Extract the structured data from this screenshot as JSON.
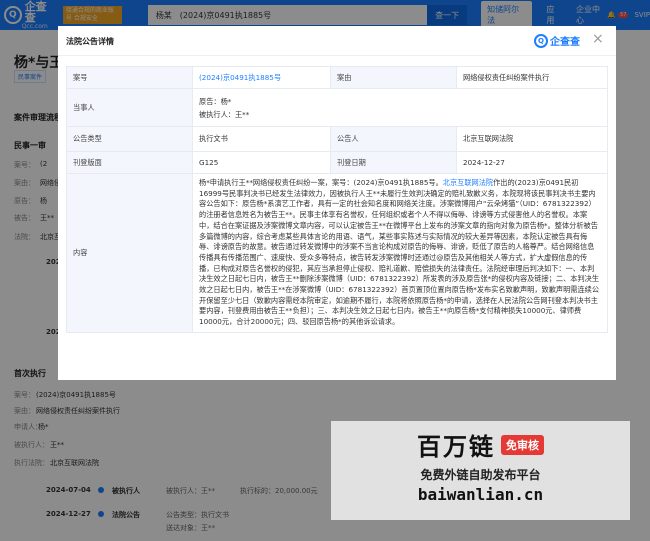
{
  "topbar": {
    "logo_text": "企查查",
    "logo_sub": "Qcc.com",
    "promo": "接通合规的商业账号 合规安全",
    "search_value": "杨某　(2024)京0491执1885号",
    "search_button": "查一下",
    "nav_item_1": "知储阿尔法",
    "nav_item_2": "应用",
    "nav_item_3": "企业中心",
    "notif_count": "57",
    "vip_label": "SVIP"
  },
  "background": {
    "company_name": "杨*与王",
    "company_tag": "民事案件",
    "section_process": "案件审理流程",
    "section_civil": "民事一审",
    "case_label": "案号：",
    "case_value": "(2",
    "cause_label": "案由：",
    "cause_value": "网络侵",
    "plaintiff_label": "原告：",
    "plaintiff_value": "杨",
    "defendant_label": "被告：",
    "defendant_value": "王**",
    "court_label": "法院：",
    "court_value": "北京互",
    "year_1": "202",
    "year_2": "202",
    "section_exec": "首次执行",
    "exec_case_label": "案号：",
    "exec_case_value": "(2024)京0491执1885号",
    "exec_cause_label": "案由：",
    "exec_cause_value": "网络侵权责任纠纷案件执行",
    "exec_applicant_label": "申请人：",
    "exec_applicant_value": "杨*",
    "exec_respondent_label": "被执行人：",
    "exec_respondent_value": "王**",
    "exec_court_label": "执行法院：",
    "exec_court_value": "北京互联网法院",
    "timeline": [
      {
        "date": "2024-07-04",
        "type": "被执行人",
        "info1": "被执行人：王**",
        "info2": "执行标的：20,000.00元"
      },
      {
        "date": "2024-12-27",
        "type": "法院公告",
        "info1": "公告类型：执行文书",
        "info2": "送达对象：王**"
      }
    ]
  },
  "modal": {
    "title": "法院公告详情",
    "logo": "企查查",
    "close": "×",
    "rows": {
      "case_no_label": "案号",
      "case_no_value": "(2024)京0491执1885号",
      "cause_label": "案由",
      "cause_value": "网络侵权责任纠纷案件执行",
      "party_label": "当事人",
      "party_plaintiff": "原告：杨*",
      "party_defendant": "被执行人：王**",
      "type_label": "公告类型",
      "type_value": "执行文书",
      "announcer_label": "公告人",
      "announcer_value": "北京互联网法院",
      "page_label": "刊登版面",
      "page_value": "G125",
      "date_label": "刊登日期",
      "date_value": "2024-12-27",
      "content_label": "内容",
      "content_pre": "杨*申请执行王**网络侵权责任纠纷一案，案号：(2024)京0491执1885号。",
      "content_link": "北京互联网法院",
      "content_post": "作出的(2023)京0491民初16999号民事判决书已经发生法律效力，因被执行人王**未履行生效判决确定的赔礼致歉义务，本院现将该民事判决书主要内容公告如下：原告杨*系演艺工作者，具有一定的社会知名度和网络关注度。涉案微博用户“云朵烤猫”（UID：6781322392）的注册者信息姓名为被告王**。民事主体享有名誉权，任何组织或者个人不得以侮辱、诽谤等方式侵害他人的名誉权。本案中，结合在案证据及涉案微博文章内容，可以认定被告王**在微博平台上发布的涉案文章的指向对象为原告杨*。整体分析被告多篇微博的内容，综合考虑某些具体言论的用语、语气，某些事实陈述与实际情况的较大差异等因素，本院认定被告具有侮辱、诽谤原告的故意。被告通过转发微博中的涉案不当言论构成对原告的侮辱、诽谤，贬低了原告的人格尊严。结合网络信息传播具有传播范围广、速度快、受众多等特点，被告转发涉案微博时还通过@原告及其他相关人等方式，扩大虚假信息的传播，已构成对原告名誉权的侵犯，其应当承担停止侵权、赔礼道歉、赔偿损失的法律责任。法院经审理后判决如下：一、本判决生效之日起七日内，被告王**删除涉案微博（UID：6781322392）所发表的涉及原告张*的侵权内容及链接；二、本判决生效之日起七日内，被告王**在涉案微博（UID：6781322392）首页置顶位置向原告杨*发布实名致歉声明，致歉声明需连续公开保留至少七日（致歉内容需经本院审定，如逾期不履行，本院将依照原告杨*的申请，选择在人民法院公告网刊登本判决书主要内容，刊登费用由被告王**负担）；三、本判决生效之日起七日内，被告王**向原告杨*支付精神损失10000元、律师费10000元，合计20000元；四、驳回原告杨*的其他诉讼请求。"
    }
  },
  "watermark": {
    "brand": "百万链",
    "tag": "免审核",
    "line2": "免费外链自助发布平台",
    "line3": "baiwanlian.cn"
  }
}
